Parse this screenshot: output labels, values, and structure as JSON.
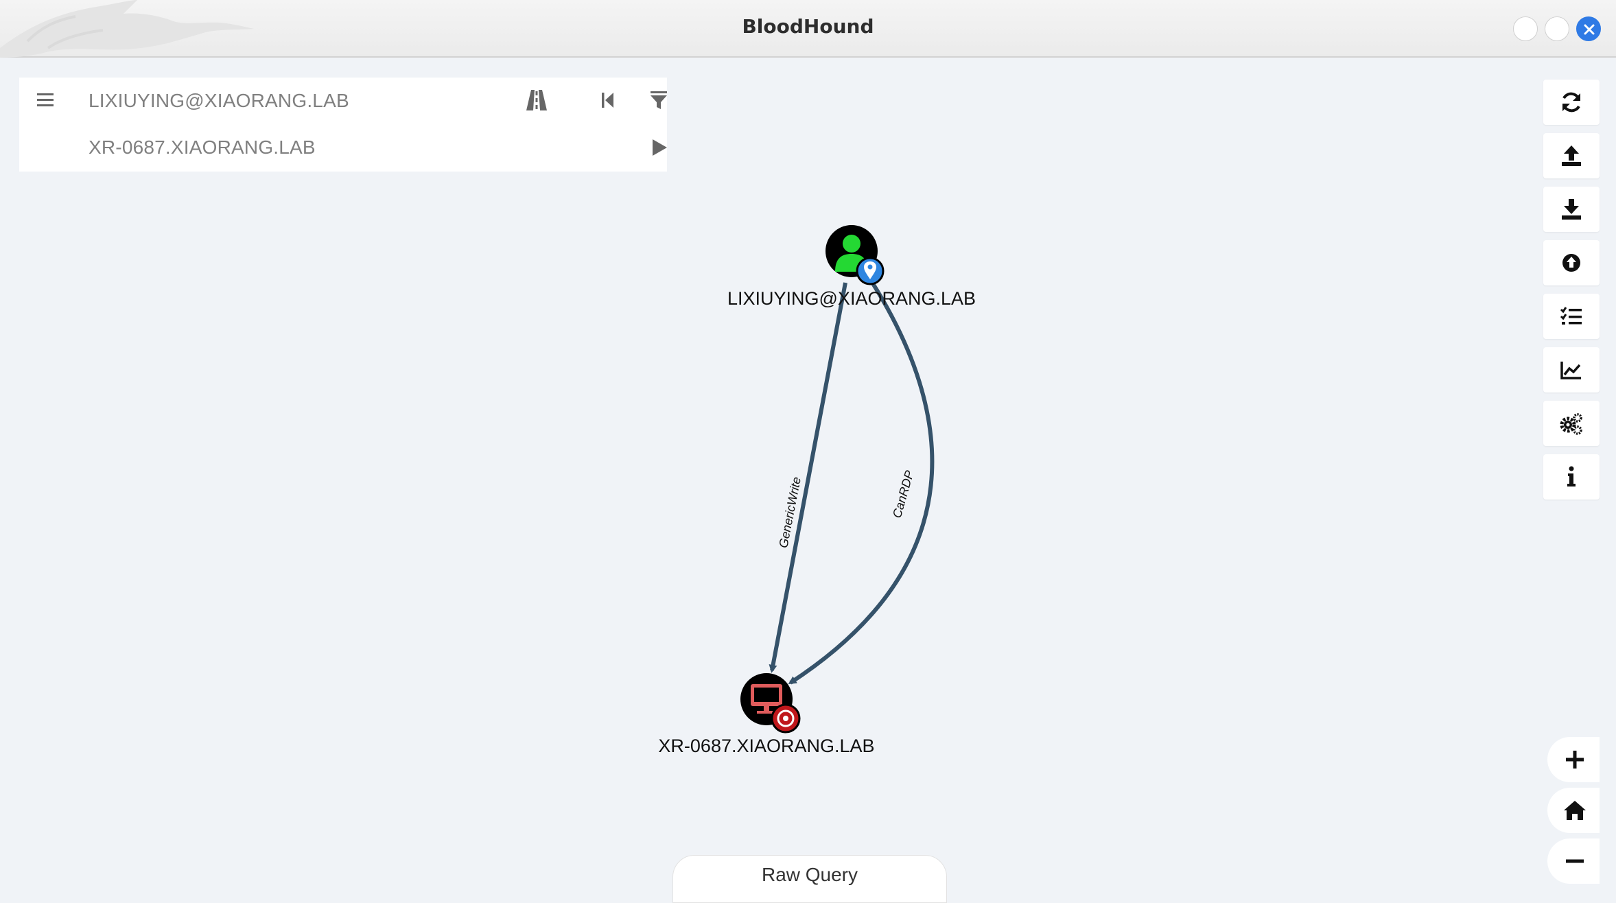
{
  "window": {
    "title": "BloodHound"
  },
  "search": {
    "start_node": "LIXIUYING@XIAORANG.LAB",
    "target_node": "XR-0687.XIAORANG.LAB"
  },
  "graph": {
    "nodes": [
      {
        "label": "LIXIUYING@XIAORANG.LAB",
        "type": "User",
        "marker": "owned"
      },
      {
        "label": "XR-0687.XIAORANG.LAB",
        "type": "Computer",
        "marker": "high-value"
      }
    ],
    "edges": [
      {
        "label": "GenericWrite"
      },
      {
        "label": "CanRDP"
      }
    ]
  },
  "toolbar": {
    "icons": [
      "refresh-icon",
      "upload-icon",
      "download-icon",
      "import-icon",
      "queries-icon",
      "stats-icon",
      "settings-icon",
      "info-icon"
    ]
  },
  "zoom": {
    "icons": [
      "zoom-in-icon",
      "home-icon",
      "zoom-out-icon"
    ]
  },
  "bottom": {
    "raw_query_label": "Raw Query"
  },
  "colors": {
    "edge": "#35526a",
    "user_icon": "#24d833",
    "computer_icon": "#e05c5c",
    "owned_badge": "#2f86e0",
    "high_value_badge": "#c0171b",
    "close_button": "#2f7ae5"
  }
}
